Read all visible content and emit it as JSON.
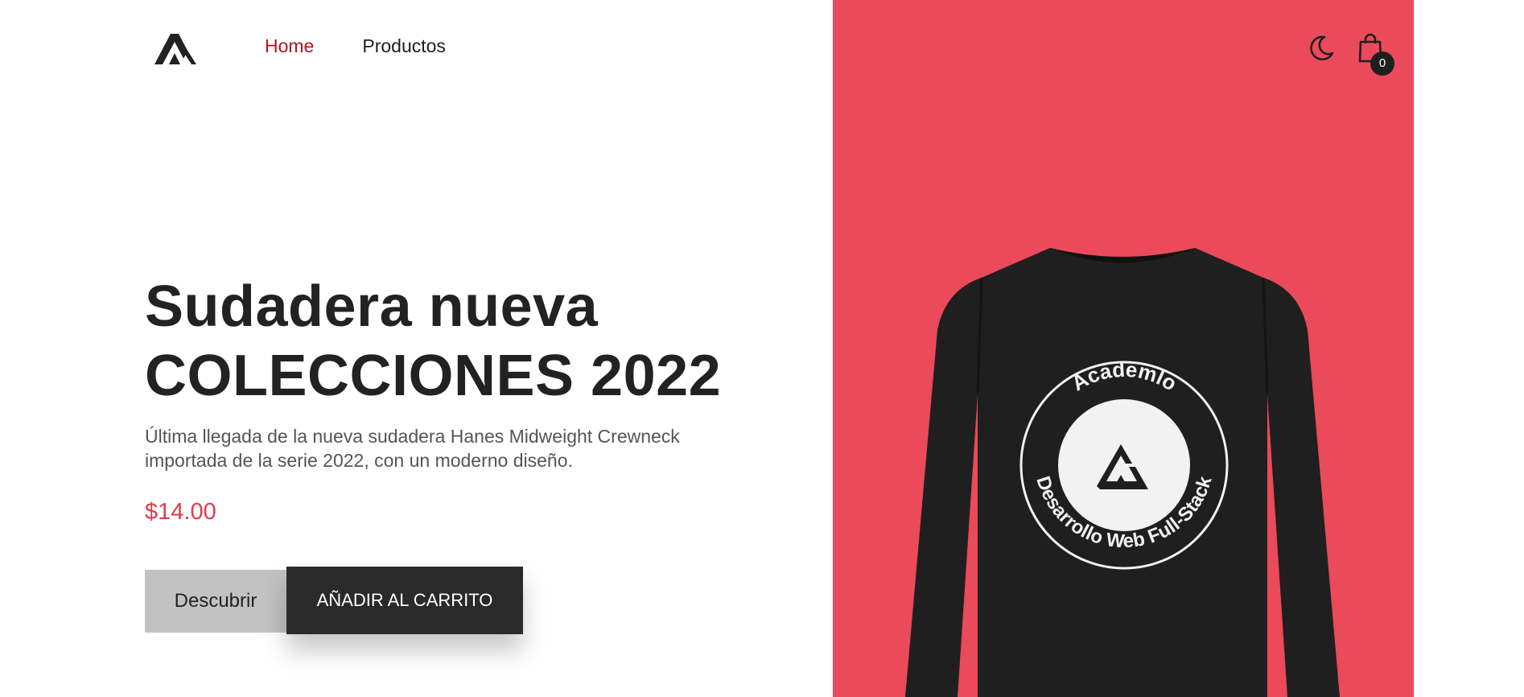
{
  "header": {
    "logo_icon": "academlo-logo-icon",
    "nav": [
      {
        "label": "Home",
        "active": true
      },
      {
        "label": "Productos",
        "active": false
      }
    ],
    "theme_icon": "moon-icon",
    "cart_icon": "shopping-bag-icon",
    "cart_count": "0"
  },
  "hero": {
    "title_line1": "Sudadera nueva",
    "title_line2": "COLECCIONES 2022",
    "description": "Última llegada de la nueva sudadera Hanes Midweight Crewneck importada de la serie 2022, con un moderno diseño.",
    "price": "$14.00",
    "discover_label": "Descubrir",
    "add_to_cart_label": "AÑADIR AL CARRITO"
  },
  "product_image": {
    "print_top": "Academlo",
    "print_bottom": "Desarrollo Web Full-Stack"
  },
  "colors": {
    "accent": "#ea4a5a",
    "nav_active": "#b0141f",
    "price": "#e23b4a",
    "dark": "#2a2a2a"
  }
}
